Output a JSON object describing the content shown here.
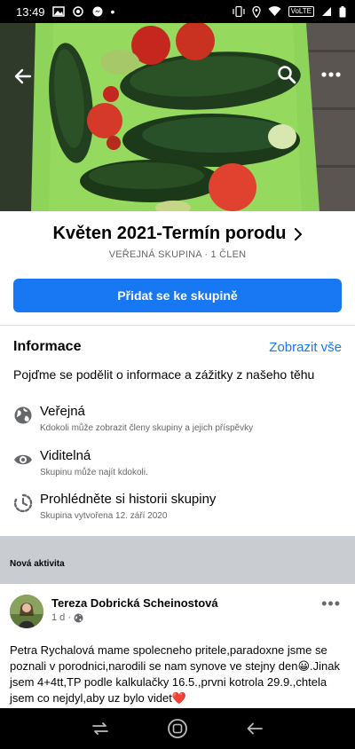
{
  "status_bar": {
    "time": "13:49",
    "network_label": "VoLTE",
    "icons": [
      "gallery-icon",
      "chrome-icon",
      "messenger-icon",
      "dot-icon"
    ],
    "right_icons": [
      "vibrate-icon",
      "location-icon",
      "wifi-icon",
      "signal-icon",
      "battery-icon"
    ]
  },
  "cover": {
    "description_icon": "vegetables-photo",
    "back_icon": "back-arrow-icon",
    "search_icon": "search-icon",
    "more_icon": "more-icon"
  },
  "group": {
    "title": "Květen 2021-Termín porodu",
    "subtitle": "VEŘEJNÁ SKUPINA · 1 ČLEN",
    "join_label": "Přidat se ke skupině"
  },
  "about": {
    "title": "Informace",
    "see_all": "Zobrazit vše",
    "description": "Pojďme se podělit o informace a zážitky z našeho těhu",
    "items": [
      {
        "icon": "globe-icon",
        "title": "Veřejná",
        "subtitle": "Kdokoli může zobrazit členy skupiny a jejich příspěvky"
      },
      {
        "icon": "eye-icon",
        "title": "Viditelná",
        "subtitle": "Skupinu může najít kdokoli."
      },
      {
        "icon": "history-icon",
        "title": "Prohlédněte si historii skupiny",
        "subtitle": "Skupina vytvořena 12. září 2020"
      }
    ]
  },
  "activity": {
    "label": "Nová aktivita"
  },
  "post": {
    "author": "Tereza Dobrická Scheinostová",
    "time": "1 d ·",
    "text": "Petra Rychalová mame spolecneho pritele,paradoxne jsme se poznali v porodnici,narodili se nam synove ve stejny den😀.Jinak jsem 4+4tt,TP podle kalkulačky 16.5.,prvni kotrola 29.9.,chtela jsem co nejdyl,aby uz bylo videt❤️",
    "more": "•••"
  },
  "colors": {
    "accent": "#1877f2",
    "secondary_text": "#65676b",
    "band": "#c9ccd1"
  }
}
